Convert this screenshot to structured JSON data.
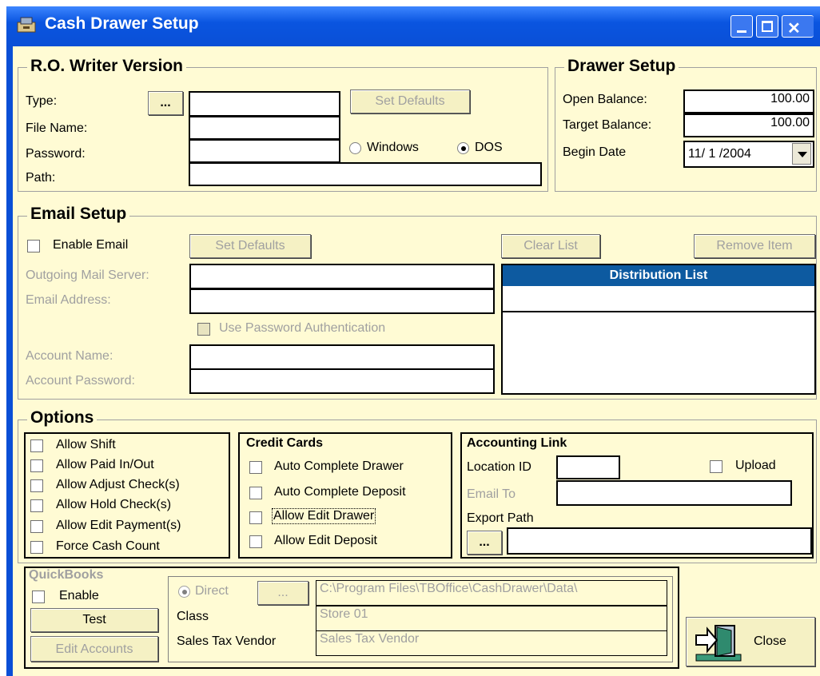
{
  "window": {
    "title": "Cash Drawer Setup"
  },
  "ro_writer": {
    "legend": "R.O. Writer Version",
    "type_label": "Type:",
    "browse_label": "...",
    "file_name_label": "File Name:",
    "password_label": "Password:",
    "path_label": "Path:",
    "type_value": "",
    "file_name_value": "",
    "password_value": "",
    "path_value": "",
    "set_defaults_label": "Set Defaults",
    "windows_label": "Windows",
    "dos_label": "DOS",
    "selected_mode": "DOS"
  },
  "drawer_setup": {
    "legend": "Drawer Setup",
    "open_balance_label": "Open Balance:",
    "open_balance_value": "100.00",
    "target_balance_label": "Target Balance:",
    "target_balance_value": "100.00",
    "begin_date_label": "Begin Date",
    "begin_date_value": "11/ 1 /2004"
  },
  "email_setup": {
    "legend": "Email Setup",
    "enable_email_label": "Enable Email",
    "enable_email_checked": false,
    "set_defaults_label": "Set Defaults",
    "clear_list_label": "Clear List",
    "remove_item_label": "Remove Item",
    "outgoing_server_label": "Outgoing Mail Server:",
    "email_address_label": "Email Address:",
    "use_password_auth_label": "Use Password Authentication",
    "account_name_label": "Account Name:",
    "account_password_label": "Account Password:",
    "distribution_list_header": "Distribution List",
    "distribution_list_items": []
  },
  "options": {
    "legend": "Options",
    "general": [
      {
        "label": "Allow Shift",
        "checked": false
      },
      {
        "label": "Allow Paid In/Out",
        "checked": false
      },
      {
        "label": "Allow Adjust Check(s)",
        "checked": false
      },
      {
        "label": "Allow Hold Check(s)",
        "checked": false
      },
      {
        "label": "Allow Edit Payment(s)",
        "checked": false
      },
      {
        "label": "Force Cash Count",
        "checked": false
      }
    ],
    "credit_cards": {
      "title": "Credit Cards",
      "items": [
        {
          "label": "Auto Complete Drawer",
          "checked": false
        },
        {
          "label": "Auto Complete Deposit",
          "checked": false
        },
        {
          "label": "Allow Edit Drawer",
          "checked": false
        },
        {
          "label": "Allow Edit Deposit",
          "checked": false
        }
      ]
    },
    "accounting_link": {
      "title": "Accounting Link",
      "location_id_label": "Location ID",
      "location_id_value": "",
      "upload_label": "Upload",
      "upload_checked": false,
      "email_to_label": "Email To",
      "email_to_value": "",
      "export_path_label": "Export Path",
      "export_path_value": "",
      "browse_label": "..."
    }
  },
  "quickbooks": {
    "title": "QuickBooks",
    "enable_label": "Enable",
    "test_label": "Test",
    "edit_accounts_label": "Edit Accounts",
    "direct_label": "Direct",
    "browse_label": "...",
    "path_value": "C:\\Program Files\\TBOffice\\CashDrawer\\Data\\",
    "class_label": "Class",
    "class_value": "Store 01",
    "sales_tax_vendor_label": "Sales Tax Vendor",
    "sales_tax_vendor_value": "Sales Tax Vendor"
  },
  "close_button": {
    "label": "Close"
  },
  "colors": {
    "titlebar": "#0a4fd6",
    "client": "#fffbd4",
    "list_header": "#0d5aa0"
  }
}
